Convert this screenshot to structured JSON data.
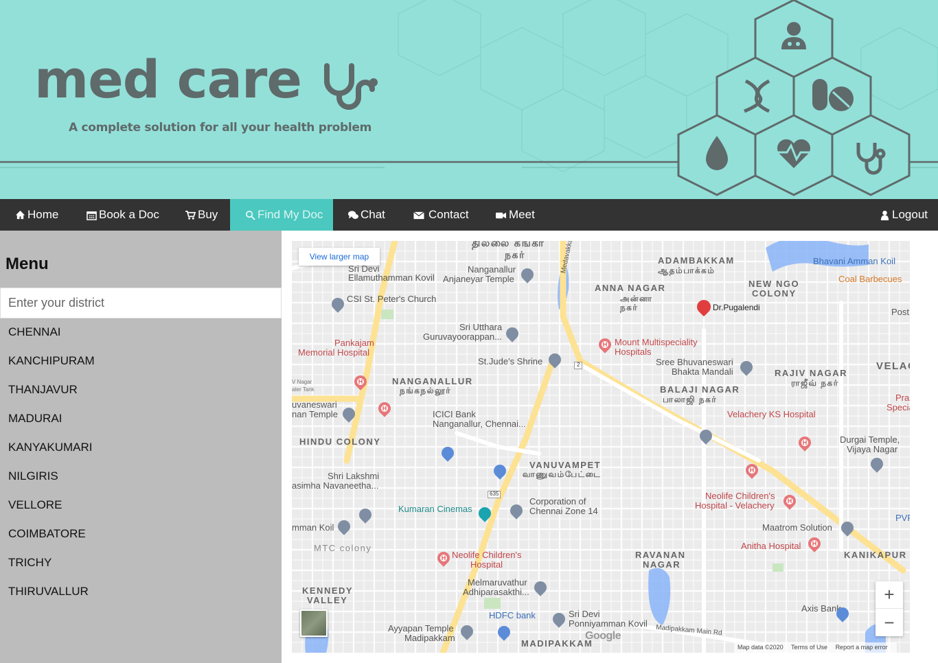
{
  "banner": {
    "title": "med care",
    "tagline": "A complete solution for all your health problem",
    "colors": {
      "background": "#93e0d9",
      "logo": "#5f6a6a"
    },
    "hex_icons": [
      "doctor-icon",
      "dna-icon",
      "pills-icon",
      "blood-drop-icon",
      "heartbeat-icon",
      "stethoscope-icon"
    ]
  },
  "navbar": {
    "colors": {
      "background": "#333333",
      "active": "#4bc8bf"
    },
    "items": [
      {
        "label": "Home",
        "icon": "home-icon"
      },
      {
        "label": "Book a Doc",
        "icon": "calendar-icon"
      },
      {
        "label": "Buy",
        "icon": "cart-icon"
      },
      {
        "label": "Find My Doc",
        "icon": "search-icon",
        "active": true
      },
      {
        "label": "Chat",
        "icon": "chat-icon"
      },
      {
        "label": "Contact",
        "icon": "envelope-icon"
      },
      {
        "label": "Meet",
        "icon": "video-icon"
      }
    ],
    "logout": {
      "label": "Logout",
      "icon": "user-icon"
    }
  },
  "sidebar": {
    "title": "Menu",
    "search_placeholder": "Enter your district",
    "districts": [
      "CHENNAI",
      "KANCHIPURAM",
      "THANJAVUR",
      "MADURAI",
      "KANYAKUMARI",
      "NILGIRIS",
      "VELLORE",
      "COIMBATORE",
      "TRICHY",
      "THIRUVALLUR"
    ]
  },
  "map": {
    "view_larger": "View larger map",
    "marker": "Dr.Pugalendi",
    "labels": {
      "adambakkam": "ADAMBAKKAM",
      "adambakkam_ta": "ஆதம்பாக்கம்",
      "anna_nagar": "ANNA NAGAR",
      "anna_nagar_ta": "அன்னா நகர்",
      "new_ngo": "NEW NGO",
      "colony": "COLONY",
      "bhavani": "Bhavani Amman Koil",
      "coal": "Coal Barbecues",
      "thillai": "தில்லை கங்கா",
      "nagar_ta": "நகர்",
      "sri_devi": "Sri Devi",
      "ellamuthamman": "Ellamuthamman Kovil",
      "anjaneyar": "Anjaneyar Temple",
      "nanganallur_top": "Nanganallur",
      "csi": "CSI St. Peter's Church",
      "sri_utthara": "Sri Utthara",
      "guruvayoorappan": "Guruvayoorappan...",
      "pankajam": "Pankajam",
      "memorial": "Memorial Hospital",
      "mount": "Mount Multispeciality",
      "hospitals": "Hospitals",
      "st_jude": "St.Jude's Shrine",
      "sree_bhuvaneswari": "Sree Bhuvaneswari",
      "bhakta": "Bhakta Mandali",
      "rajiv_nagar": "RAJIV NAGAR",
      "rajiv_ta": "ராஜீவ் நகர்",
      "velac": "VELAC",
      "nanganallur": "NANGANALLUR",
      "nanganallur_ta": "நங்கநல்லூர்",
      "balaji_nagar": "BALAJI NAGAR",
      "balaji_ta": "பாலாஜி நகர்",
      "icici": "ICICI Bank",
      "icici2": "Nanganallur, Chennai...",
      "velachery_ks": "Velachery KS Hospital",
      "prash": "Prash",
      "speciali": "Speciali",
      "durgai": "Durgai Temple,",
      "vijaya": "Vijaya Nagar",
      "hindu_colony": "HINDU COLONY",
      "vanuvampet": "VANUVAMPET",
      "vanuvampet_ta": "வாணுவம்பேட்டை",
      "shri_lakshmi": "Shri Lakshmi",
      "asimha": "asimha Navaneetha...",
      "kumaran": "Kumaran Cinemas",
      "corporation": "Corporation of",
      "chennai_zone": "Chennai Zone 14",
      "neolife_right": "Neolife Children's",
      "hospital_velachery": "Hospital - Velachery",
      "maatrom": "Maatrom Solution",
      "pvr": "PVR C",
      "amman_koil": "mman Koil",
      "mtc_colony": "MTC colony",
      "anitha": "Anitha Hospital",
      "kanikapur": "KANIKAPUR",
      "neolife_left": "Neolife Children's",
      "hospital": "Hospital",
      "ravanan": "RAVANAN",
      "ravanan2": "NAGAR",
      "kennedy": "KENNEDY",
      "valley": "VALLEY",
      "melmaruvathur": "Melmaruvathur",
      "adhiparasakthi": "Adhiparasakthi...",
      "axis": "Axis Bank",
      "hdfc": "HDFC bank",
      "sri_devi2": "Sri Devi",
      "ponniyamman": "Ponniyamman Kovil",
      "ayyapan": "Ayyapan Temple",
      "madipakkam": "Madipakkam",
      "madipakkam_caps": "MADIPAKKAM",
      "medavakkam": "Medavakkam Main Rd",
      "madipakkam_rd": "Madipakkam Main Rd",
      "vnagar": "V Nagar",
      "water_tank": "ater Tank",
      "uvaneswari": "uvaneswari",
      "nan_temple": "nan Temple",
      "post": "Post",
      "road_635": "635",
      "road_2": "2"
    },
    "google": "Google",
    "footer": {
      "map_data": "Map data ©2020",
      "terms": "Terms of Use",
      "report": "Report a map error"
    },
    "zoom_in": "+",
    "zoom_out": "−"
  }
}
